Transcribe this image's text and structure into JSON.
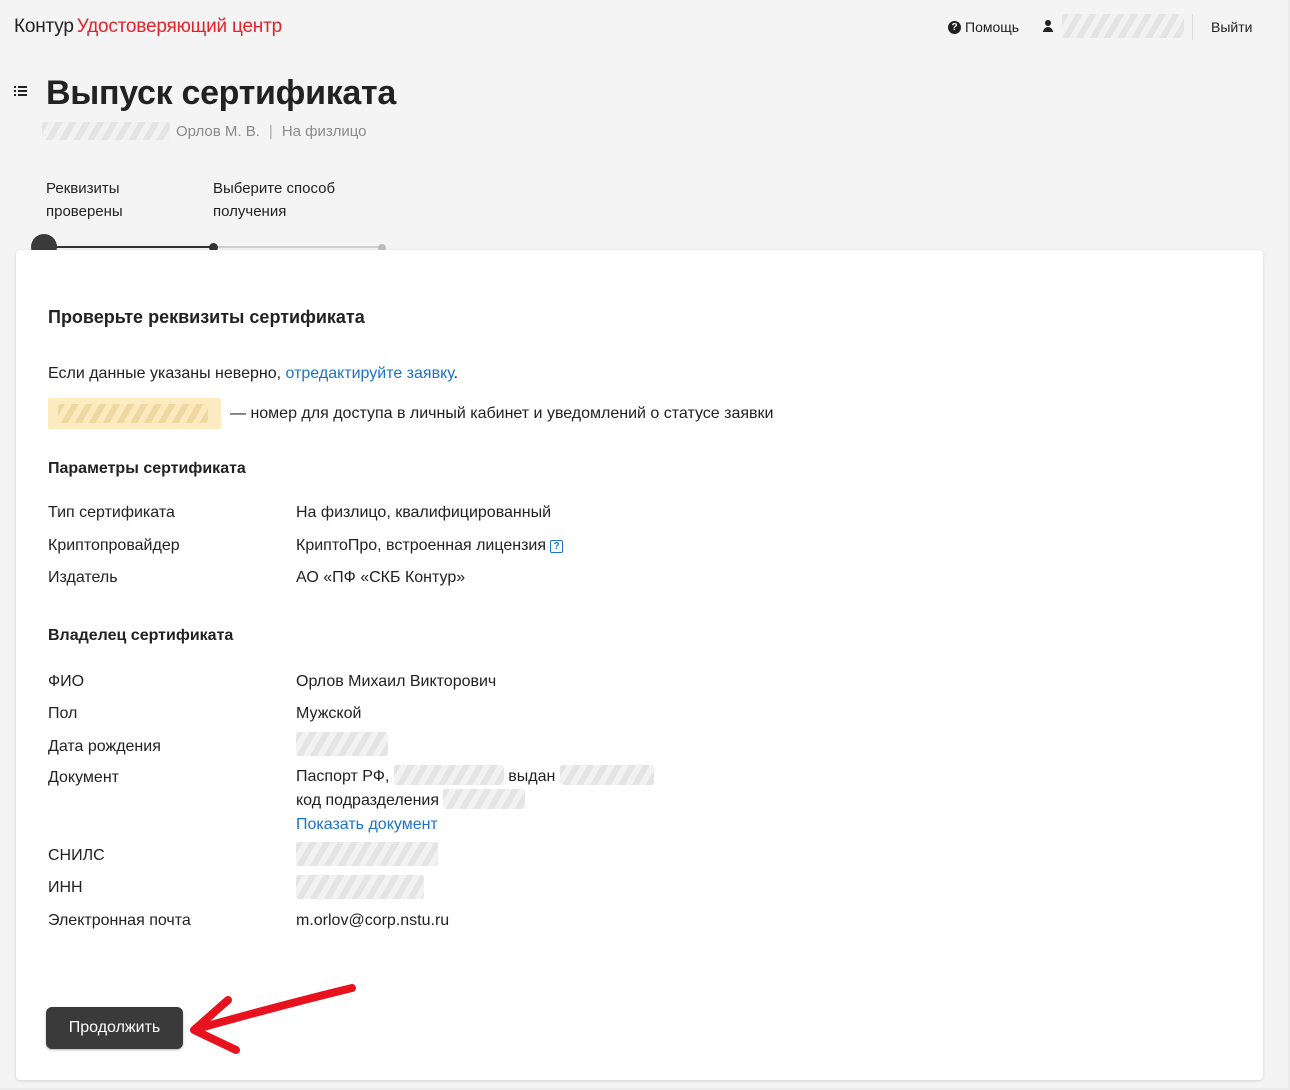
{
  "header": {
    "brand": "Контур",
    "product": "Удостоверяющий центр",
    "help_label": "Помощь",
    "logout_label": "Выйти"
  },
  "page": {
    "title": "Выпуск сертификата",
    "subtitle_name": "Орлов М. В.",
    "subtitle_separator": "|",
    "subtitle_type": "На физлицо"
  },
  "stepper": {
    "steps": [
      {
        "label_line1": "Реквизиты",
        "label_line2": "проверены"
      },
      {
        "label_line1": "Выберите способ",
        "label_line2": "получения"
      }
    ]
  },
  "card": {
    "heading": "Проверьте реквизиты сертификата",
    "edit_prefix": "Если данные указаны неверно, ",
    "edit_link": "отредактируйте заявку",
    "edit_suffix": ".",
    "phone_note": "— номер для доступа в личный кабинет и уведомлений о статусе заявки",
    "params_heading": "Параметры сертификата",
    "params": [
      {
        "label": "Тип сертификата",
        "value": "На физлицо, квалифицированный"
      },
      {
        "label": "Криптопровайдер",
        "value": "КриптоПро, встроенная лицензия"
      },
      {
        "label": "Издатель",
        "value": "АО «ПФ «СКБ Контур»"
      }
    ],
    "owner_heading": "Владелец сертификата",
    "owner": {
      "fio_label": "ФИО",
      "fio_value": "Орлов Михаил Викторович",
      "gender_label": "Пол",
      "gender_value": "Мужской",
      "dob_label": "Дата рождения",
      "doc_label": "Документ",
      "doc_line1_prefix": "Паспорт РФ,",
      "doc_line1_issued": "выдан",
      "doc_line2": "код подразделения",
      "doc_link": "Показать документ",
      "snils_label": "СНИЛС",
      "inn_label": "ИНН",
      "email_label": "Электронная почта",
      "email_value": "m.orlov@corp.nstu.ru"
    },
    "continue_label": "Продолжить"
  },
  "colors": {
    "brand_red": "#e3232a",
    "link_blue": "#1a73c8",
    "button_dark": "#3a3a3a",
    "annotation_arrow": "#e8121e",
    "phone_highlight": "#fdecc2"
  },
  "icons": [
    "help-icon",
    "user-icon",
    "menu-list-icon",
    "info-icon",
    "annotation-arrow"
  ]
}
